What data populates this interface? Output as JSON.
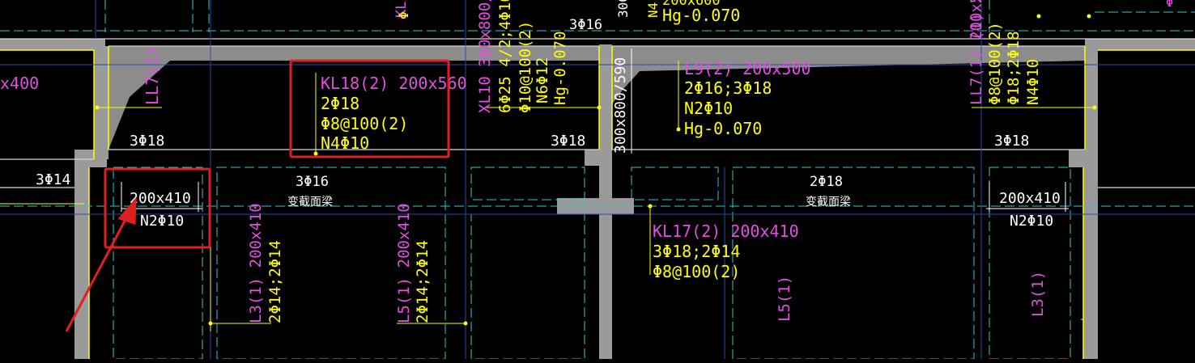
{
  "colors": {
    "background": "#000000",
    "wall": "#9a9a9a",
    "beam_fill": "#8c8c8c",
    "yellow": "#ffff00",
    "magenta": "#e24fe2",
    "white": "#ffffff",
    "cyan": "#2ec8d6",
    "blue": "#2a4aa8",
    "highlight": "#e02020"
  },
  "labels": {
    "top_kl": "KL",
    "top_phi": "Φ",
    "top_3phi16": "3Φ16",
    "top_n4": "N4",
    "top_200x600": "200x600",
    "top_hg": "Hg-0.070",
    "top_300": "300",
    "top_phi_small": "Φ",
    "top_right_56": "(1) 200x56",
    "left_x400": "x400",
    "ll7_left": "LL7(1)",
    "kl18_title": "KL18(2) 200x560",
    "kl18_bars": "2Φ18",
    "kl18_stirrup": "Φ8@100(2)",
    "kl18_n": "N4Φ10",
    "xl10_line1": "XL10 300x800/",
    "xl10_line2": "6Φ25 4/2;4Φ16",
    "xl10_line3": "Φ10@100(2)",
    "xl10_line4": "N6Φ12",
    "xl10_line5": "Hg-0.070",
    "section_300": "300x800/590",
    "l9_title": "L9(2) 200x500",
    "l9_bars": "2Φ16;3Φ18",
    "l9_n": "N2Φ10",
    "l9_hg": "Hg-0.070",
    "ll7_right_title": "LL7(1) 200x560",
    "ll7_right_stirrup": "Φ8@100(2)",
    "ll7_right_bars": "Φ18;2Φ18",
    "ll7_right_n": "N4Φ10",
    "bar_3phi18_a": "3Φ18",
    "bar_3phi18_b": "3Φ18",
    "bar_3phi18_c": "3Φ18",
    "bar_3phi14": "3Φ14",
    "sec_left_dim": "200x410",
    "sec_left_n": "N2Φ10",
    "mid_3phi16": "3Φ16",
    "mid_var1": "变截面梁",
    "right_2phi18": "2Φ18",
    "right_var2": "变截面梁",
    "sec_right_dim": "200x410",
    "sec_right_n": "N2Φ10",
    "kl17_title": "KL17(2) 200x410",
    "kl17_bars": "3Φ18;2Φ14",
    "kl17_stirrup": "Φ8@100(2)",
    "l3_left_title": "L3(1) 200x410",
    "l3_left_bars": "2Φ14;2Φ14",
    "l5_left_title": "L5(1) 200x410",
    "l5_left_bars": "2Φ14;2Φ14",
    "l5_right": "L5(1)",
    "l3_right": "L3(1)"
  }
}
